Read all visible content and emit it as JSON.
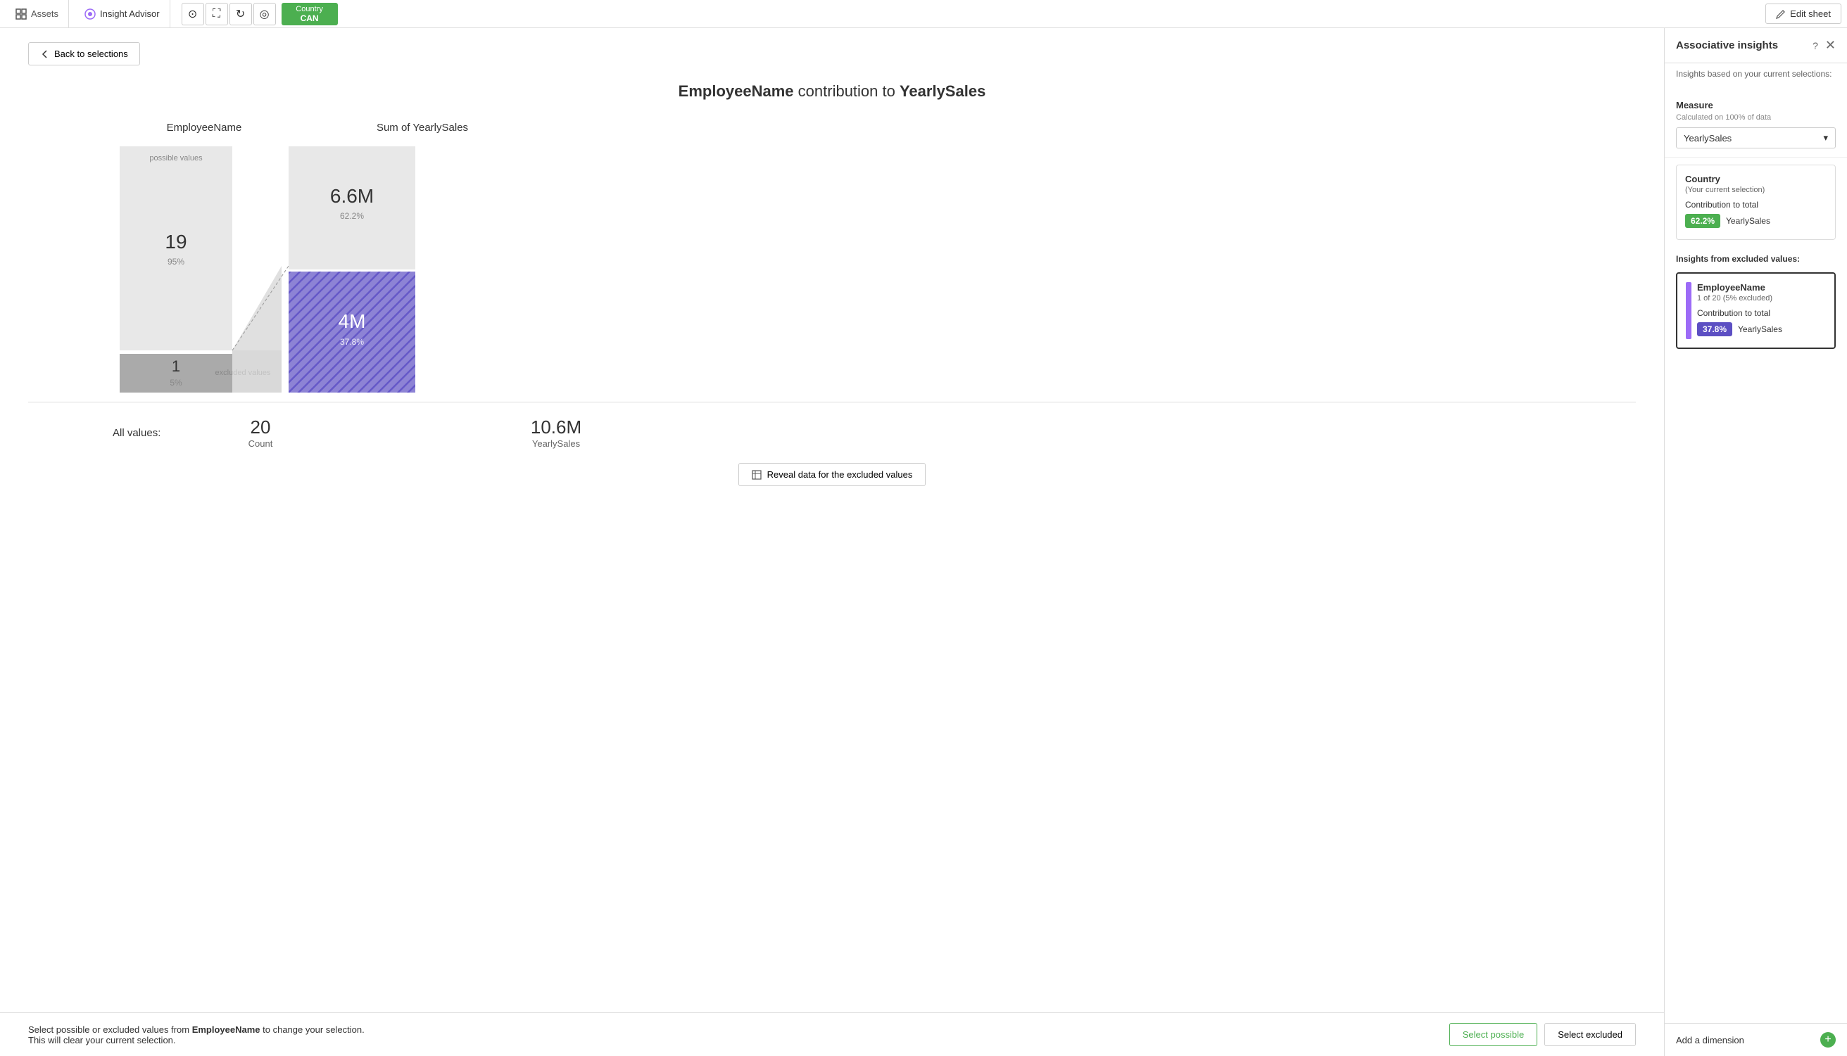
{
  "nav": {
    "assets_label": "Assets",
    "insight_advisor_label": "Insight Advisor",
    "selection_field": "Country",
    "selection_value": "CAN",
    "edit_sheet_label": "Edit sheet"
  },
  "back_button_label": "Back to selections",
  "chart": {
    "title_field": "EmployeeName",
    "title_verb": "contribution to",
    "title_measure": "YearlySales",
    "left_col_header": "EmployeeName",
    "right_col_header": "Sum of YearlySales",
    "possible_label": "possible values",
    "excluded_label": "excluded values",
    "left_possible_value": "19",
    "left_possible_pct": "95%",
    "left_excluded_value": "1",
    "left_excluded_pct": "5%",
    "right_possible_value": "6.6M",
    "right_possible_pct": "62.2%",
    "right_excluded_value": "4M",
    "right_excluded_pct": "37.8%",
    "all_values_label": "All values:",
    "all_values_count": "20",
    "all_values_count_label": "Count",
    "all_values_sum": "10.6M",
    "all_values_sum_label": "YearlySales"
  },
  "reveal_btn_label": "Reveal data for the excluded values",
  "bottom_bar": {
    "text_prefix": "Select possible or excluded values from",
    "field_name": "EmployeeName",
    "text_suffix": "to change your selection. This will clear your current selection.",
    "select_possible_label": "Select possible",
    "select_excluded_label": "Select excluded"
  },
  "sidebar": {
    "title": "Associative insights",
    "description": "Insights based on your current selections:",
    "measure_label": "Measure",
    "measure_sublabel": "Calculated on 100% of data",
    "measure_value": "YearlySales",
    "country_card": {
      "title": "Country",
      "subtitle": "(Your current selection)",
      "contrib_label": "Contribution to total",
      "contrib_pct": "62.2%",
      "contrib_measure": "YearlySales"
    },
    "excluded_insights_label": "Insights from excluded values:",
    "employee_card": {
      "title": "EmployeeName",
      "subtitle": "1 of 20 (5% excluded)",
      "contrib_label": "Contribution to total",
      "contrib_pct": "37.8%",
      "contrib_measure": "YearlySales"
    },
    "add_dimension_label": "Add a dimension"
  }
}
